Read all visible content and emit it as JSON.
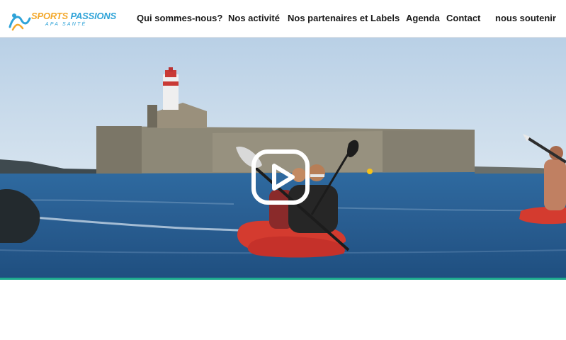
{
  "brand": {
    "name_part1": "SPORTS",
    "name_part2": "PASSIONS",
    "tagline": "APA SANTÉ",
    "colors": {
      "orange": "#f3a82b",
      "blue": "#2fa3d8",
      "teal": "#1eab8f"
    }
  },
  "nav": {
    "items": [
      {
        "label": "Qui sommes-nous?"
      },
      {
        "label": "Nos activité"
      },
      {
        "label": "Nos partenaires et Labels"
      },
      {
        "label": "Agenda"
      },
      {
        "label": "Contact"
      },
      {
        "label": "nous soutenir"
      }
    ]
  },
  "hero": {
    "play_icon": "play-icon",
    "scene": "sea-kayak-fort-lighthouse"
  }
}
